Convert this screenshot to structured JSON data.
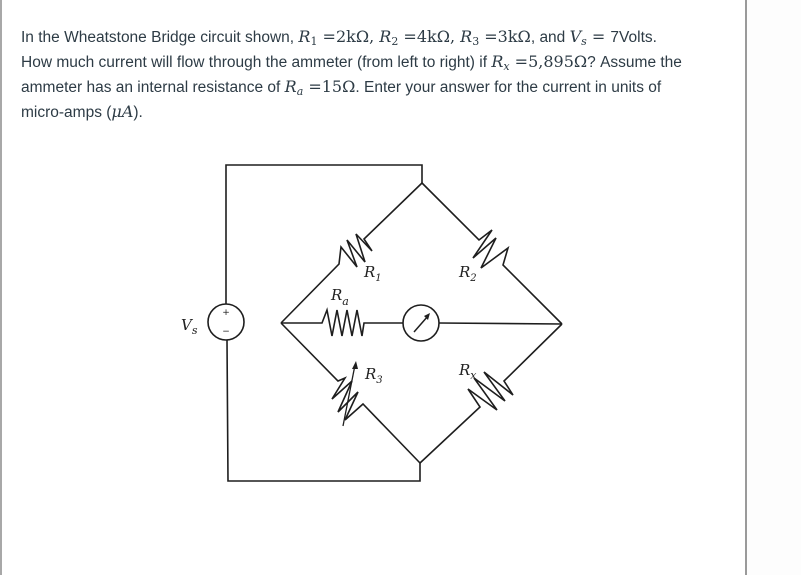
{
  "question": {
    "line1": {
      "t1": "In the Wheatstone Bridge circuit shown, ",
      "r1_sym": "R",
      "r1_sub": "1",
      "r1_val": " =2kΩ, ",
      "r2_sym": "R",
      "r2_sub": "2",
      "r2_val": " =4kΩ, ",
      "r3_sym": "R",
      "r3_sub": "3",
      "r3_val": " =3kΩ",
      "t2": ", and ",
      "vs_sym": "V",
      "vs_sub": "s",
      "vs_eq": " = ",
      "t3": "7Volts."
    },
    "line2": {
      "t1": "How much current will flow through the ammeter (from left to right) if ",
      "rx_sym": "R",
      "rx_sub": "x",
      "rx_val": " =5,895Ω",
      "t2": "?  Assume the"
    },
    "line3": {
      "t1": "ammeter has an internal resistance of ",
      "ra_sym": "R",
      "ra_sub": "a",
      "ra_val": " =15Ω",
      "t2": ".  Enter your answer for the current in units of"
    },
    "line4": {
      "t1": "micro-amps (",
      "unit": "μA",
      "t2": ")."
    }
  },
  "circuit": {
    "source_label": {
      "sym": "V",
      "sub": "s"
    },
    "source_plus": "+",
    "source_minus": "−",
    "labels": {
      "r1": {
        "sym": "R",
        "sub": "1"
      },
      "r2": {
        "sym": "R",
        "sub": "2"
      },
      "r3": {
        "sym": "R",
        "sub": "3"
      },
      "rx": {
        "sym": "R",
        "sub": "x"
      },
      "ra": {
        "sym": "R",
        "sub": "a"
      }
    },
    "ammeter_icon": "ammeter-meter-icon",
    "source_icon": "voltage-source-icon"
  }
}
